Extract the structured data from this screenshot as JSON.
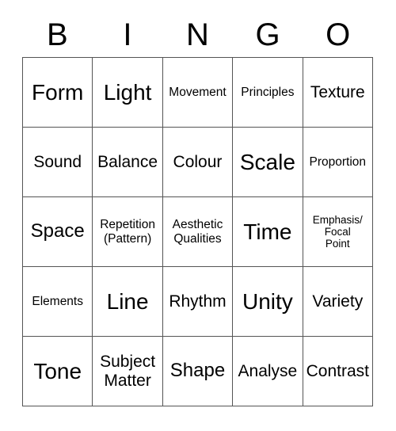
{
  "card": {
    "header_letters": [
      "B",
      "I",
      "N",
      "G",
      "O"
    ],
    "colors": {
      "text": "#000000",
      "border": "#555555",
      "background": "#ffffff"
    },
    "rows": [
      [
        {
          "label": "Form",
          "size": "fs-xl"
        },
        {
          "label": "Light",
          "size": "fs-xl"
        },
        {
          "label": "Movement",
          "size": "fs-sm"
        },
        {
          "label": "Principles",
          "size": "fs-sm"
        },
        {
          "label": "Texture",
          "size": "fs-md"
        }
      ],
      [
        {
          "label": "Sound",
          "size": "fs-md"
        },
        {
          "label": "Balance",
          "size": "fs-md"
        },
        {
          "label": "Colour",
          "size": "fs-md"
        },
        {
          "label": "Scale",
          "size": "fs-xl"
        },
        {
          "label": "Proportion",
          "size": "fs-sm"
        }
      ],
      [
        {
          "label": "Space",
          "size": "fs-lg"
        },
        {
          "label": "Repetition\n(Pattern)",
          "size": "fs-sm"
        },
        {
          "label": "Aesthetic\nQualities",
          "size": "fs-sm"
        },
        {
          "label": "Time",
          "size": "fs-xl"
        },
        {
          "label": "Emphasis/\nFocal\nPoint",
          "size": "fs-xs"
        }
      ],
      [
        {
          "label": "Elements",
          "size": "fs-sm"
        },
        {
          "label": "Line",
          "size": "fs-xl"
        },
        {
          "label": "Rhythm",
          "size": "fs-md"
        },
        {
          "label": "Unity",
          "size": "fs-xl"
        },
        {
          "label": "Variety",
          "size": "fs-md"
        }
      ],
      [
        {
          "label": "Tone",
          "size": "fs-xl"
        },
        {
          "label": "Subject\nMatter",
          "size": "fs-md"
        },
        {
          "label": "Shape",
          "size": "fs-lg"
        },
        {
          "label": "Analyse",
          "size": "fs-md"
        },
        {
          "label": "Contrast",
          "size": "fs-md"
        }
      ]
    ]
  }
}
